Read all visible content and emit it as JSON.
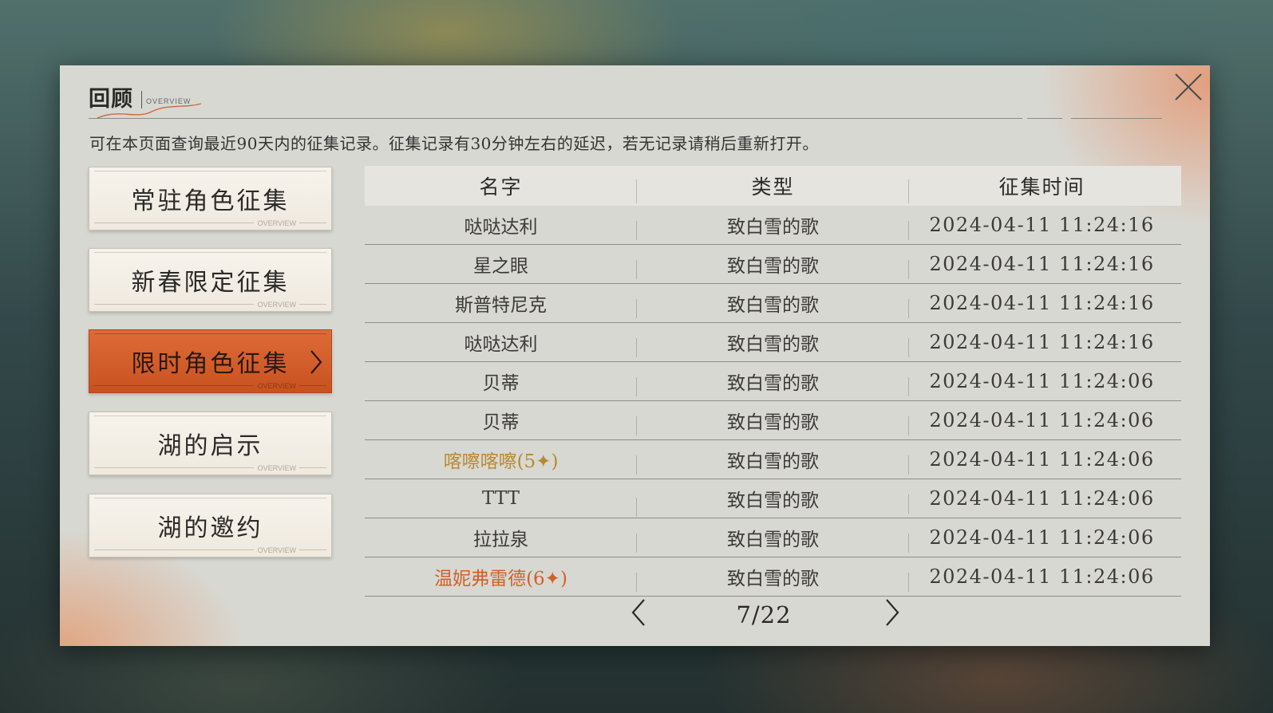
{
  "header": {
    "title": "回顾",
    "subtitle": "OVERVIEW",
    "description": "可在本页面查询最近90天内的征集记录。征集记录有30分钟左右的延迟，若无记录请稍后重新打开。"
  },
  "categories": [
    {
      "label": "常驻角色征集",
      "tag": "OVERVIEW",
      "active": false
    },
    {
      "label": "新春限定征集",
      "tag": "OVERVIEW",
      "active": false
    },
    {
      "label": "限时角色征集",
      "tag": "OVERVIEW",
      "active": true
    },
    {
      "label": "湖的启示",
      "tag": "OVERVIEW",
      "active": false
    },
    {
      "label": "湖的邀约",
      "tag": "OVERVIEW",
      "active": false
    }
  ],
  "table": {
    "columns": [
      "名字",
      "类型",
      "征集时间"
    ],
    "rows": [
      {
        "name": "哒哒达利",
        "type": "致白雪的歌",
        "time": "2024-04-11 11:24:16",
        "rarity": "normal"
      },
      {
        "name": "星之眼",
        "type": "致白雪的歌",
        "time": "2024-04-11 11:24:16",
        "rarity": "normal"
      },
      {
        "name": "斯普特尼克",
        "type": "致白雪的歌",
        "time": "2024-04-11 11:24:16",
        "rarity": "normal"
      },
      {
        "name": "哒哒达利",
        "type": "致白雪的歌",
        "time": "2024-04-11 11:24:16",
        "rarity": "normal"
      },
      {
        "name": "贝蒂",
        "type": "致白雪的歌",
        "time": "2024-04-11 11:24:06",
        "rarity": "normal"
      },
      {
        "name": "贝蒂",
        "type": "致白雪的歌",
        "time": "2024-04-11 11:24:06",
        "rarity": "normal"
      },
      {
        "name": "喀嚓喀嚓(5✦)",
        "type": "致白雪的歌",
        "time": "2024-04-11 11:24:06",
        "rarity": "rare4"
      },
      {
        "name": "TTT",
        "type": "致白雪的歌",
        "time": "2024-04-11 11:24:06",
        "rarity": "normal"
      },
      {
        "name": "拉拉泉",
        "type": "致白雪的歌",
        "time": "2024-04-11 11:24:06",
        "rarity": "normal"
      },
      {
        "name": "温妮弗雷德(6✦)",
        "type": "致白雪的歌",
        "time": "2024-04-11 11:24:06",
        "rarity": "rare5"
      }
    ]
  },
  "pagination": {
    "current": "7/22"
  },
  "colors": {
    "accent": "#d2602a",
    "rare4": "#b8892d",
    "panel": "#d8d8d2"
  },
  "icons": {
    "close": "close-icon",
    "prev": "chevron-left-icon",
    "next": "chevron-right-icon",
    "active_arrow": "chevron-right-icon"
  }
}
